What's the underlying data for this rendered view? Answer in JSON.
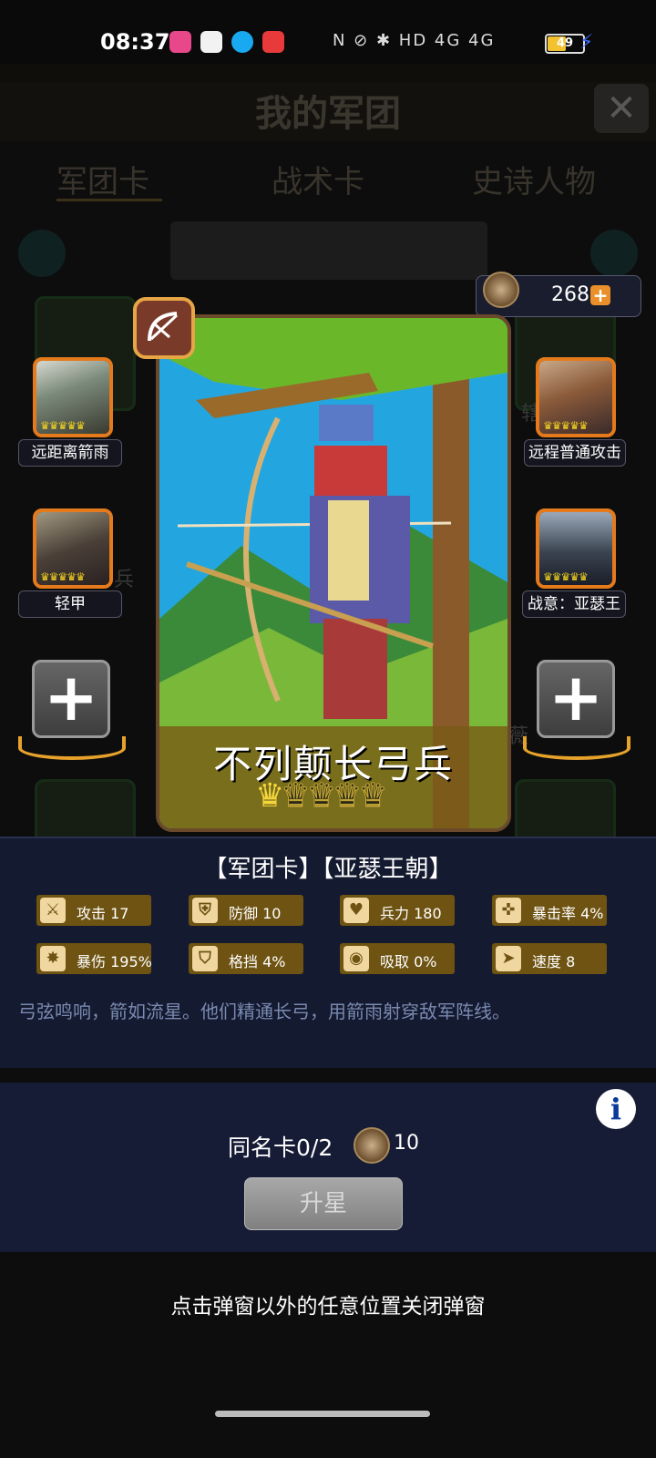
{
  "status_bar": {
    "time": "08:37",
    "icons_text": "N  ⊘  ✱  HD  4G  4G",
    "battery": "49"
  },
  "background_page": {
    "title": "我的军团",
    "tabs": [
      "军团卡",
      "战术卡",
      "史诗人物"
    ],
    "card_labels": [
      "辖",
      "兵",
      "薇"
    ]
  },
  "currency": {
    "icon": "crest-icon",
    "value": "268",
    "plus": "+"
  },
  "skills_left": [
    {
      "label": "远距离箭雨",
      "crowns": "♛♛♛♛♛"
    },
    {
      "label": "轻甲",
      "crowns": "♛♛♛♛♛"
    }
  ],
  "skills_right": [
    {
      "label": "远程普通攻击",
      "crowns": "♛♛♛♛♛"
    },
    {
      "label": "战意：亚瑟王",
      "crowns": "♛♛♛♛♛"
    }
  ],
  "add_slot": {
    "symbol": "+"
  },
  "card": {
    "name": "不列颠长弓兵",
    "stars": 1,
    "max_stars": 5,
    "class_icon": "bow-icon"
  },
  "card_type": "【军团卡】【亚瑟王朝】",
  "stats": [
    {
      "icon": "sword-icon",
      "glyph": "⚔",
      "text": "攻击 17"
    },
    {
      "icon": "shield-icon",
      "glyph": "⛨",
      "text": "防御 10"
    },
    {
      "icon": "heart-icon",
      "glyph": "♥",
      "text": "兵力 180"
    },
    {
      "icon": "crosshair-icon",
      "glyph": "✜",
      "text": "暴击率 4%"
    },
    {
      "icon": "burst-icon",
      "glyph": "✸",
      "text": "暴伤 195%"
    },
    {
      "icon": "block-icon",
      "glyph": "⛉",
      "text": "格挡 4%"
    },
    {
      "icon": "absorb-icon",
      "glyph": "◉",
      "text": "吸取 0%"
    },
    {
      "icon": "speed-icon",
      "glyph": "➤",
      "text": "速度 8"
    }
  ],
  "flavor": "弓弦鸣响，箭如流星。他们精通长弓，用箭雨射穿敌军阵线。",
  "upgrade": {
    "info": "i",
    "dup_text": "同名卡0/2",
    "cost": "10",
    "button": "升星"
  },
  "hint": "点击弹窗以外的任意位置关闭弹窗"
}
